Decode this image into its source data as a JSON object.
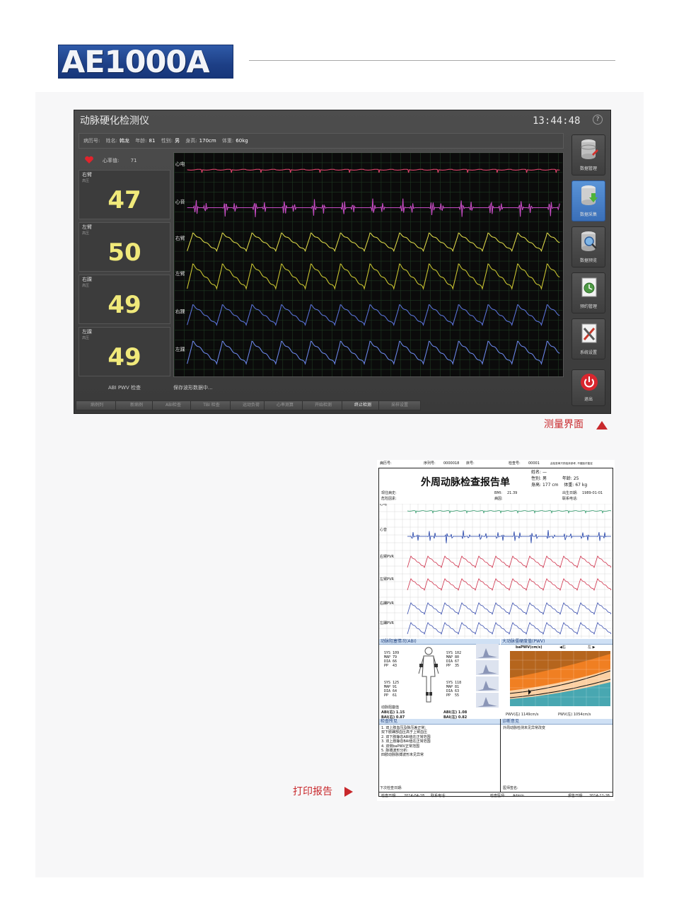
{
  "brand": {
    "model": "AE1000A"
  },
  "monitor": {
    "title": "动脉硬化检测仪",
    "clock": "13:44:48",
    "help": "?",
    "patient": {
      "id_label": "病历号:",
      "name_label": "姓名:",
      "name": "韩龙",
      "age_label": "年龄:",
      "age": "81",
      "sex_label": "性别:",
      "sex": "男",
      "height_label": "身高:",
      "height": "170cm",
      "weight_label": "体重:",
      "weight": "60kg"
    },
    "heart_rate_label": "心率值:",
    "heart_rate": "71",
    "limbs": [
      {
        "label": "右臂",
        "sub": "高压",
        "value": "47"
      },
      {
        "label": "左臂",
        "sub": "高压",
        "value": "50"
      },
      {
        "label": "右踝",
        "sub": "高压",
        "value": "49"
      },
      {
        "label": "左踝",
        "sub": "高压",
        "value": "49"
      }
    ],
    "wave_labels": [
      "心电",
      "心音",
      "右臂",
      "左臂",
      "右踝",
      "左踝"
    ],
    "status_left": "ABI PWV 检查",
    "status_right": "保存波形数据中...",
    "bottom_buttons": [
      "病例列",
      "新病例",
      "ABI检查",
      "TBI 检查",
      "运动负荷",
      "心率测算",
      "开始检测",
      "终止检测",
      "采样设置"
    ],
    "side_buttons": [
      {
        "label": "数据管理",
        "icon": "database-edit-icon"
      },
      {
        "label": "数据采集",
        "icon": "database-download-icon"
      },
      {
        "label": "数据预览",
        "icon": "database-search-icon"
      },
      {
        "label": "预约管理",
        "icon": "schedule-clock-icon"
      },
      {
        "label": "系统设置",
        "icon": "settings-tools-icon"
      },
      {
        "label": "退出",
        "icon": "power-icon"
      }
    ]
  },
  "captions": {
    "measure": "测量界面",
    "print": "打印报告"
  },
  "report": {
    "header": {
      "case_no": "病历号:",
      "seq_no": "序列号:",
      "seq_val": "0000018",
      "bed_no": "床号:",
      "check_no": "检查号:",
      "check_val": "00001",
      "note": "此检查单只供临床参考, 不做医疗鉴定"
    },
    "title": "外周动脉检查报告单",
    "name_label": "姓名:",
    "name_val": "—",
    "sex_label": "性别:",
    "sex_val": "男",
    "age_label": "年龄:",
    "age_val": "25",
    "height_label": "身高:",
    "height_val": "177",
    "height_unit": "cm",
    "weight_label": "体重:",
    "weight_val": "67",
    "weight_unit": "kg",
    "birth_label": "出生日期:",
    "birth_val": "1989-01-01",
    "history_label": "现往病史:",
    "risk_label": "危险因素:",
    "bmi_label": "BMI:",
    "bmi_val": "21.39",
    "cause_label": "病因:",
    "contact_label": "联系电话:",
    "wave_labels": [
      "心电",
      "心音",
      "右臂PVR",
      "左臂PVR",
      "右踝PVR",
      "左踝PVR"
    ],
    "sec_abi": "动脉阻塞情况(ABI)",
    "sec_pwv": "大动脉僵硬度值(PWV)",
    "pwv_title": "baPWV(cm/s)",
    "pwv_right": "◀右",
    "pwv_left": "左 ▶",
    "pwv_r_val": "PWV(右) 1149cm/s",
    "pwv_l_val": "PWV(左) 1054cm/s",
    "upper_r": {
      "sys": "109",
      "map": "79",
      "dia": "66",
      "pp": "43"
    },
    "upper_l": {
      "sys": "102",
      "map": "80",
      "dia": "67",
      "pp": "35"
    },
    "lower_r": {
      "sys": "125",
      "map": "91",
      "dia": "64",
      "pp": "61"
    },
    "lower_l": {
      "sys": "118",
      "map": "81",
      "dia": "63",
      "pp": "55"
    },
    "abi_title": "动脉阻塞值",
    "abi_r": "ABI(右) 1.15",
    "bai_r": "BAI(右) 0.87",
    "abi_l": "ABI(左) 1.08",
    "bai_l": "BAI(左) 0.82",
    "sec_desc": "检查所见",
    "sec_diag": "诊断意见",
    "findings": [
      "1.  双上肢血压及脉压差正常;",
      "    双下肢踝部血压高于上臂血压",
      "2.  双下肢静息ABI值在正常范围",
      "3.  双上肢静息BAI值在正常范围",
      "4.  双侧baPWV正常范围",
      "5.  脉搏波形分析:",
      "    四肢动脉脉搏波形未见异常"
    ],
    "diagnosis": "外周动脉检测未见异常改变",
    "next_date": "下次检查日期:",
    "doctor_sign": "医师签名:",
    "footer": {
      "check_date_label": "检查日期:",
      "check_date": "2014-04-18",
      "contact": "联系电话:",
      "doctor_label": "检查医师:",
      "doctor": "Admin",
      "report_date_label": "报告日期:",
      "report_date": "2014-11-26"
    }
  }
}
